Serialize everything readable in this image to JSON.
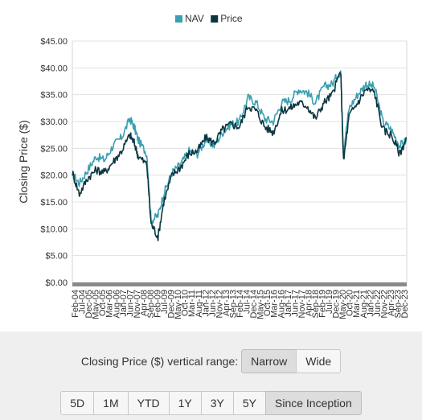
{
  "chart_data": {
    "type": "line",
    "ylabel": "Closing Price ($)",
    "ylim": [
      0,
      45
    ],
    "yticks": [
      "$0.00",
      "$5.00",
      "$10.00",
      "$15.00",
      "$20.00",
      "$25.00",
      "$30.00",
      "$35.00",
      "$40.00",
      "$45.00"
    ],
    "yticks_values": [
      0,
      5,
      10,
      15,
      20,
      25,
      30,
      35,
      40,
      45
    ],
    "xticks": [
      "Feb-04",
      "Jul-04",
      "Dec-04",
      "May-05",
      "Oct-05",
      "Mar-06",
      "Aug-06",
      "Jan-07",
      "Jun-07",
      "Nov-07",
      "Apr-08",
      "Sep-08",
      "Feb-09",
      "Jul-09",
      "Dec-09",
      "May-10",
      "Oct-10",
      "Mar-11",
      "Aug-11",
      "Jan-12",
      "Jun-12",
      "Nov-12",
      "Apr-13",
      "Sep-13",
      "Feb-14",
      "Jul-14",
      "Dec-14",
      "May-15",
      "Oct-15",
      "Mar-16",
      "Aug-16",
      "Jan-17",
      "Jun-17",
      "Nov-17",
      "Apr-18",
      "Sep-18",
      "Feb-19",
      "Jul-19",
      "Dec-19",
      "May-20",
      "Oct-20",
      "Mar-21",
      "Aug-21",
      "Jan-22",
      "Jun-22",
      "Nov-22",
      "Apr-23",
      "Sep-23",
      "Dec-23"
    ],
    "xticks_visible": [
      "Feb-04",
      "Jul-04",
      "Dec-05",
      "May-05",
      "Oct-05",
      "Mar-06",
      "Aug-06",
      "Jan-07",
      "Jun-07",
      "Nov-07",
      "Apr-08",
      "Sep-08",
      "Feb-09",
      "Jul-09",
      "Dec-09",
      "May-10",
      "Oct-10",
      "Mar-11",
      "Aug-11",
      "Jan-12",
      "Jun-12",
      "Nov-12",
      "Apr-13",
      "Sep-13",
      "Feb-14",
      "Jul-14",
      "Dec-14",
      "May-15",
      "Oct-15",
      "Mar-16",
      "Aug-16",
      "Jan-17",
      "Jun-17",
      "Nov-17",
      "Apr-18",
      "Sep-18",
      "Feb-19",
      "Jul-19",
      "Dec-19",
      "May-20",
      "Oct-20",
      "Mar-21",
      "Aug-21",
      "Jan-22",
      "Jun-22",
      "Nov-22",
      "Apr-23",
      "Sep-23",
      "Dec-23"
    ],
    "legend_position": "top-center",
    "grid": true,
    "series": [
      {
        "name": "NAV",
        "color": "#3a9fb0",
        "x": [
          "2004-02",
          "2004-07",
          "2005-01",
          "2005-07",
          "2006-01",
          "2006-07",
          "2007-01",
          "2007-07",
          "2007-10",
          "2008-01",
          "2008-07",
          "2008-10",
          "2009-03",
          "2009-07",
          "2010-01",
          "2010-07",
          "2011-01",
          "2011-07",
          "2012-01",
          "2012-07",
          "2013-01",
          "2013-07",
          "2014-01",
          "2014-07",
          "2015-01",
          "2015-07",
          "2016-01",
          "2016-07",
          "2017-01",
          "2017-07",
          "2018-01",
          "2018-07",
          "2019-01",
          "2019-07",
          "2020-01",
          "2020-03",
          "2020-07",
          "2021-01",
          "2021-07",
          "2022-01",
          "2022-07",
          "2023-01",
          "2023-07",
          "2023-12"
        ],
        "values": [
          20.2,
          18.5,
          21.0,
          23.5,
          22.8,
          25.5,
          27.0,
          30.5,
          29.0,
          26.5,
          24.0,
          11.5,
          12.5,
          16.5,
          20.5,
          22.0,
          24.5,
          24.0,
          26.5,
          25.5,
          28.0,
          29.5,
          30.0,
          34.5,
          33.5,
          30.5,
          30.0,
          33.5,
          34.0,
          36.0,
          35.5,
          33.5,
          36.5,
          37.0,
          39.5,
          24.5,
          32.5,
          35.0,
          37.0,
          36.5,
          30.0,
          28.5,
          25.5,
          26.5
        ]
      },
      {
        "name": "Price",
        "color": "#0b3640",
        "x": [
          "2004-02",
          "2004-07",
          "2005-01",
          "2005-07",
          "2006-01",
          "2006-07",
          "2007-01",
          "2007-07",
          "2007-10",
          "2008-01",
          "2008-07",
          "2008-10",
          "2009-03",
          "2009-07",
          "2010-01",
          "2010-07",
          "2011-01",
          "2011-07",
          "2012-01",
          "2012-07",
          "2013-01",
          "2013-07",
          "2014-01",
          "2014-07",
          "2015-01",
          "2015-07",
          "2016-01",
          "2016-07",
          "2017-01",
          "2017-07",
          "2018-01",
          "2018-07",
          "2019-01",
          "2019-07",
          "2020-01",
          "2020-03",
          "2020-07",
          "2021-01",
          "2021-07",
          "2022-01",
          "2022-07",
          "2023-01",
          "2023-07",
          "2023-12"
        ],
        "values": [
          20.5,
          16.5,
          19.5,
          21.0,
          20.5,
          22.5,
          24.5,
          27.5,
          26.0,
          23.5,
          22.0,
          11.0,
          8.5,
          15.0,
          20.0,
          21.5,
          24.0,
          24.5,
          27.0,
          26.0,
          28.5,
          29.5,
          29.0,
          33.0,
          32.0,
          29.0,
          28.0,
          32.0,
          32.5,
          33.5,
          33.0,
          30.5,
          33.5,
          35.0,
          39.5,
          22.5,
          31.0,
          33.5,
          36.0,
          35.5,
          28.5,
          27.5,
          24.0,
          27.0
        ]
      }
    ]
  },
  "controls": {
    "range_label": "Closing Price ($) vertical range:",
    "range_buttons": [
      "Narrow",
      "Wide"
    ],
    "range_active": "Narrow",
    "period_buttons": [
      "5D",
      "1M",
      "YTD",
      "1Y",
      "3Y",
      "5Y",
      "Since Inception"
    ],
    "period_active": "Since Inception"
  },
  "colors": {
    "accent_nav": "#3a9fb0",
    "accent_price": "#0b3640",
    "axis_bar": "#8a8a8a",
    "grid": "#e0e0e0",
    "panel": "#efefef"
  }
}
